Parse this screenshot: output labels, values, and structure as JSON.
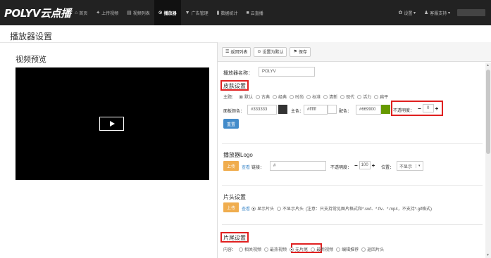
{
  "topbar": {
    "logo": "POLYV云点播",
    "nav": [
      {
        "label": "首页",
        "icon": "⌂"
      },
      {
        "label": "上传视频",
        "icon": "✦"
      },
      {
        "label": "视频列表",
        "icon": "▤"
      },
      {
        "label": "播放器",
        "icon": "⊙"
      },
      {
        "label": "广告管理",
        "icon": "▼"
      },
      {
        "label": "数据统计",
        "icon": "▮"
      },
      {
        "label": "云直播",
        "icon": "■"
      }
    ],
    "settings": "设置",
    "support": "客服支持"
  },
  "page_title": "播放器设置",
  "preview_title": "视频预览",
  "toolbar": {
    "back": "返回列表",
    "set_default": "设置为默认",
    "save": "保存"
  },
  "form": {
    "name_label": "播放器名称：",
    "name_value": "POLYV",
    "skin_title": "皮肤设置",
    "theme_label": "主题：",
    "themes": [
      "默认",
      "古典",
      "经典",
      "时尚",
      "标准",
      "清新",
      "现代",
      "活力",
      "扁平"
    ],
    "panel_color_label": "面板颜色：",
    "panel_color": "#333333",
    "main_color_label": "主色：",
    "main_color": "#ffffff",
    "accent_color_label": "配色：",
    "accent_color": "#669900",
    "opacity_label": "不透明度：",
    "opacity_value": "0",
    "reset": "重置",
    "logo_title": "播放器Logo",
    "upload": "上传",
    "view": "查看",
    "link_label": "链接：",
    "link_value": "#",
    "logo_opacity_label": "不透明度：",
    "logo_opacity": "100",
    "position_label": "位置：",
    "position_value": "不显示",
    "head_title": "片头设置",
    "head_show": "显示片头",
    "head_hide": "不显示片头",
    "head_note": "(注意：只支持常见图片格式和*.swf、*.flv、*.mp4，不支持*.gif格式)",
    "tail_title": "片尾设置",
    "tail_content_label": "内容：",
    "tail_options": [
      "相关视频",
      "最热视频",
      "无片尾",
      "最新视频",
      "编辑推荐",
      "返回片头"
    ]
  },
  "colors": {
    "topbar": "#222222",
    "panel_swatch": "#333333",
    "main_swatch": "#ffffff",
    "accent_swatch": "#669900",
    "highlight": "#e02020"
  }
}
